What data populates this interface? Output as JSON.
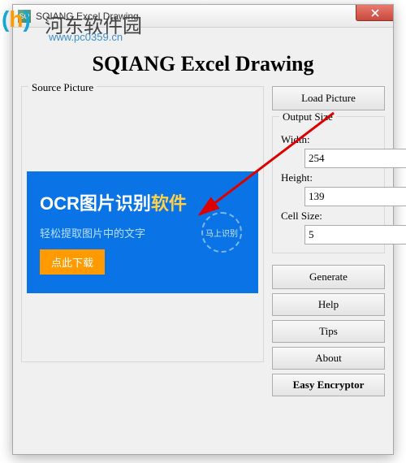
{
  "watermark": {
    "site_name": "河东软件园",
    "url": "www.pc0359.cn"
  },
  "window": {
    "title": "SQIANG Excel Drawing",
    "close_label": "×"
  },
  "heading": "SQIANG Excel Drawing",
  "source": {
    "label": "Source Picture",
    "picture": {
      "title_prefix": "OCR",
      "title_main": "图片识别",
      "title_suffix": "软件",
      "subtitle": "轻松提取图片中的文字",
      "button": "点此下载",
      "circle": "马上识别"
    }
  },
  "controls": {
    "load_picture": "Load Picture",
    "output_size": "Output Size",
    "width_label": "Width:",
    "width_value": "254",
    "height_label": "Height:",
    "height_value": "139",
    "cell_size_label": "Cell Size:",
    "cell_size_value": "5",
    "generate": "Generate",
    "help": "Help",
    "tips": "Tips",
    "about": "About",
    "easy_encryptor": "Easy Encryptor"
  }
}
